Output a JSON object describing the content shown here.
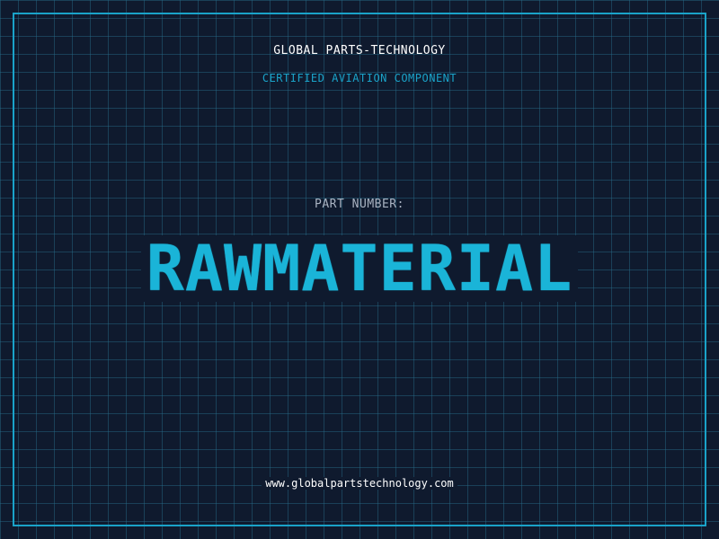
{
  "header": {
    "company": "GLOBAL PARTS-TECHNOLOGY",
    "tagline": "CERTIFIED AVIATION COMPONENT"
  },
  "part": {
    "label": "PART NUMBER:",
    "number": "RAWMATERIAL"
  },
  "footer": {
    "url": "www.globalpartstechnology.com"
  },
  "colors": {
    "background": "#0f1a2e",
    "accent": "#1ab4d8",
    "grid": "#286e8c"
  }
}
